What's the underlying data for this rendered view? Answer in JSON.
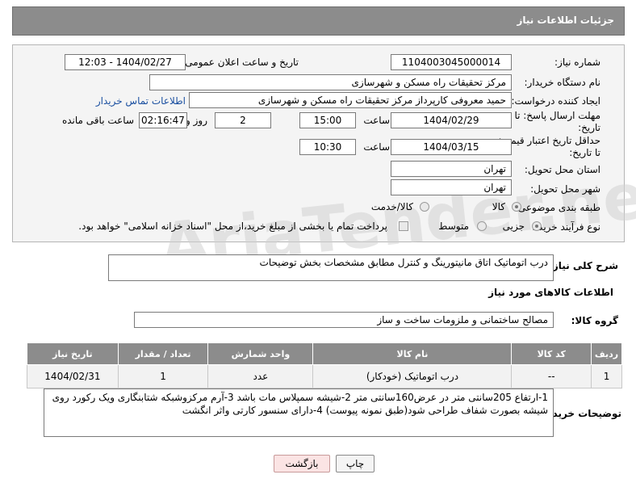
{
  "header": {
    "title": "جزئیات اطلاعات نیاز"
  },
  "fields": {
    "need_number_label": "شماره نیاز:",
    "need_number": "1104003045000014",
    "announce_label": "تاریخ و ساعت اعلان عمومی:",
    "announce_value": "1404/02/27 - 12:03",
    "buyer_org_label": "نام دستگاه خریدار:",
    "buyer_org": "مرکز تحقیقات راه  مسکن و شهرسازی",
    "creator_label": "ایجاد کننده درخواست:",
    "creator": "حمید معروفی کارپرداز مرکز تحقیقات راه  مسکن و شهرسازی",
    "contact_link": "اطلاعات تماس خریدار",
    "deadline_label": "مهلت ارسال پاسخ: تا تاریخ:",
    "deadline_date": "1404/02/29",
    "time_label": "ساعت",
    "deadline_time": "15:00",
    "days_value": "2",
    "days_label": "روز و",
    "remaining_time": "02:16:47",
    "remaining_label": "ساعت باقی مانده",
    "price_validity_label": "حداقل تاریخ اعتبار قیمت: تا تاریخ:",
    "price_date": "1404/03/15",
    "price_time": "10:30",
    "province_label": "استان محل تحویل:",
    "province": "تهران",
    "city_label": "شهر محل تحویل:",
    "city": "تهران",
    "category_label": "طبقه بندی موضوعی:",
    "category_options": [
      "کالا",
      "کالا/خدمت"
    ],
    "process_label": "نوع فرآیند خرید :",
    "process_options": [
      "جزیی",
      "متوسط"
    ],
    "payment_note": "پرداخت تمام یا بخشی از مبلغ خرید،از محل \"اسناد خزانه اسلامی\" خواهد بود."
  },
  "description": {
    "label": "شرح کلی نیاز:",
    "value": "درب اتوماتیک اتاق مانیتورینگ و کنترل مطابق مشخصات بخش توضیحات"
  },
  "goods": {
    "section_title": "اطلاعات کالاهای مورد نیاز",
    "group_label": "گروه کالا:",
    "group_value": "مصالح ساختمانی و ملزومات ساخت و ساز",
    "columns": [
      "ردیف",
      "کد کالا",
      "نام کالا",
      "واحد شمارش",
      "تعداد / مقدار",
      "تاریخ نیاز"
    ],
    "rows": [
      {
        "row": "1",
        "code": "--",
        "name": "درب اتوماتیک (خودکار)",
        "unit": "عدد",
        "qty": "1",
        "date": "1404/02/31"
      }
    ]
  },
  "buyer_notes": {
    "label": "توضیحات خریدار:",
    "value": "1-ارتفاع 205سانتی متر در عرض160سانتی متر    2-شیشه سمپلاس مات باشد  3-آرم مرکزوشبکه شتابنگاری ویک رکورد روی شیشه بصورت شفاف طراحی شود(طبق نمونه پیوست)  4-دارای سنسور کارتی واثر انگشت"
  },
  "buttons": {
    "print": "چاپ",
    "back": "بازگشت"
  },
  "watermark": "AriaTender.neT"
}
